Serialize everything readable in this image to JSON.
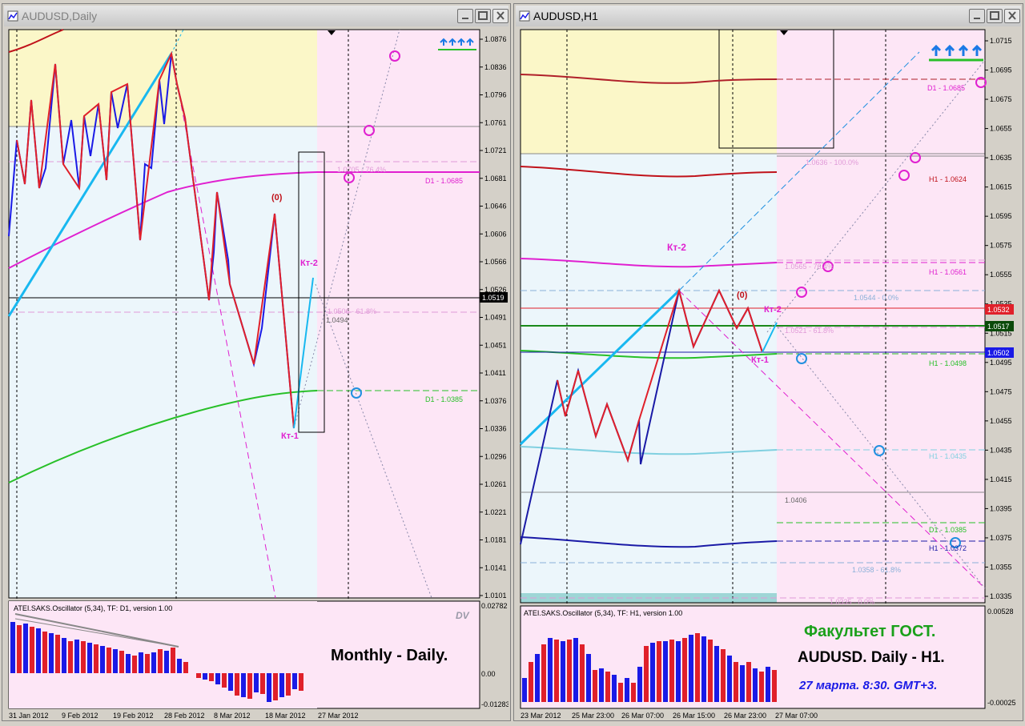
{
  "left": {
    "title": "AUDUSD,Daily",
    "price_labels": [
      "1.0876",
      "1.0836",
      "1.0796",
      "1.0761",
      "1.0721",
      "1.0681",
      "1.0646",
      "1.0606",
      "1.0566",
      "1.0526",
      "1.0491",
      "1.0451",
      "1.0411",
      "1.0376",
      "1.0336",
      "1.0296",
      "1.0261",
      "1.0221",
      "1.0181",
      "1.0141",
      "1.0101"
    ],
    "current_price": "1.0519",
    "date_labels": [
      "31 Jan 2012",
      "9 Feb 2012",
      "19 Feb 2012",
      "28 Feb 2012",
      "8 Mar 2012",
      "18 Mar 2012",
      "27 Mar 2012"
    ],
    "annotations": {
      "d1_top": "D1 - 1.0685",
      "d1_bottom": "D1 - 1.0385",
      "fib_764": "1.0705 - 76.4%",
      "fib_618": "1.0506 - 61.8%",
      "fib_price": "1.0494",
      "zero": "(0)",
      "kt1": "Кт-1",
      "kt2": "Кт-2"
    },
    "oscillator": {
      "title": "ATEI.SAKS.Oscillator (5,34), TF: D1, version 1.00",
      "scale": [
        "0.02782",
        "0.00",
        "-0.01283"
      ],
      "logo": "DV",
      "caption": "Monthly - Daily."
    }
  },
  "right": {
    "title": "AUDUSD,H1",
    "price_labels": [
      "1.0715",
      "1.0695",
      "1.0675",
      "1.0655",
      "1.0635",
      "1.0615",
      "1.0595",
      "1.0575",
      "1.0555",
      "1.0535",
      "1.0515",
      "1.0495",
      "1.0475",
      "1.0455",
      "1.0435",
      "1.0415",
      "1.0395",
      "1.0375",
      "1.0355",
      "1.0335"
    ],
    "tags": {
      "red": "1.0532",
      "green": "1.0517",
      "blue": "1.0502"
    },
    "date_labels": [
      "23 Mar 2012",
      "25 Mar 23:00",
      "26 Mar 07:00",
      "26 Mar 15:00",
      "26 Mar 23:00",
      "27 Mar 07:00"
    ],
    "annotations": {
      "d1_top": "D1 - 1.0685",
      "h1_1": "H1 - 1.0624",
      "fib_100": "1.0636 - 100.0%",
      "fib_764": "1.0565 - 76.4%",
      "h1_2": "H1 - 1.0561",
      "fib_0": "1.0544 - 0.0%",
      "fib_mid": "1.0521 - 61.8%",
      "h1_3": "H1 - 1.0498",
      "h1_4": "H1 - 1.0435",
      "price_1": "1.0406",
      "d1_bottom": "D1 - 1.0385",
      "h1_5": "H1 - 1.0372",
      "fib_618": "1.0358 - 61.8%",
      "fib_00": "1.0335 - 0.0%",
      "zero": "(0)",
      "kt1": "Кт-1",
      "kt2": "Кт-2",
      "kt2_upper": "Кт-2"
    },
    "oscillator": {
      "title": "ATEI.SAKS.Oscillator (5,34), TF: H1, version 1.00",
      "scale": [
        "0.00528",
        "-0.00025"
      ],
      "caption1": "Факультет ГОСТ.",
      "caption2": "AUDUSD. Daily - H1.",
      "caption3": "27 марта. 8:30. GMT+3."
    }
  },
  "colors": {
    "bear": "#e0202a",
    "bull": "#1a1ae6",
    "pink_bg": "#fde6f6",
    "yellow_bg": "#fbf7c8",
    "blue_bg": "#ecf6fb"
  }
}
